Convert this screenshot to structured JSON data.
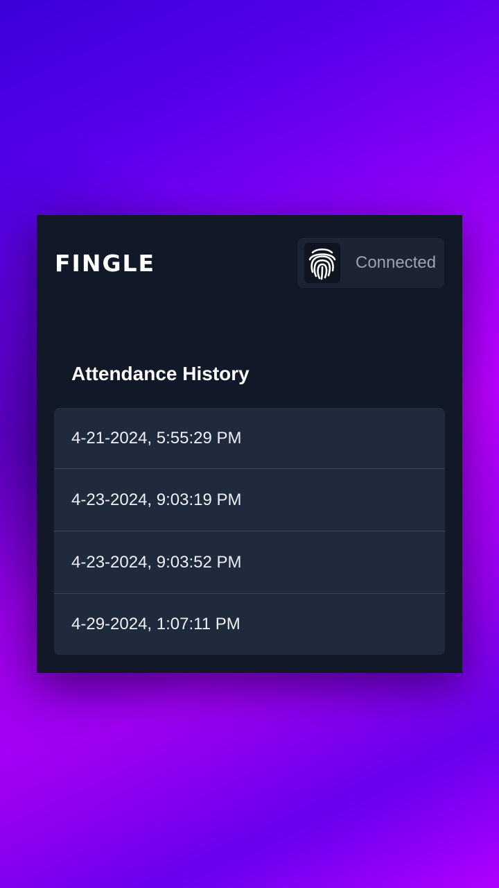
{
  "app": {
    "title": "FINGLE"
  },
  "device": {
    "icon": "fingerprint-icon",
    "status": "Connected"
  },
  "history": {
    "title": "Attendance History",
    "entries": [
      "4-21-2024, 5:55:29 PM",
      "4-23-2024, 9:03:19 PM",
      "4-23-2024, 9:03:52 PM",
      "4-29-2024, 1:07:11 PM"
    ]
  },
  "colors": {
    "card_background": "#111827",
    "list_background": "#1f2a3c",
    "status_pill": "#1c2333",
    "background_gradient": [
      "#3a00d8",
      "#bb00ff"
    ]
  }
}
